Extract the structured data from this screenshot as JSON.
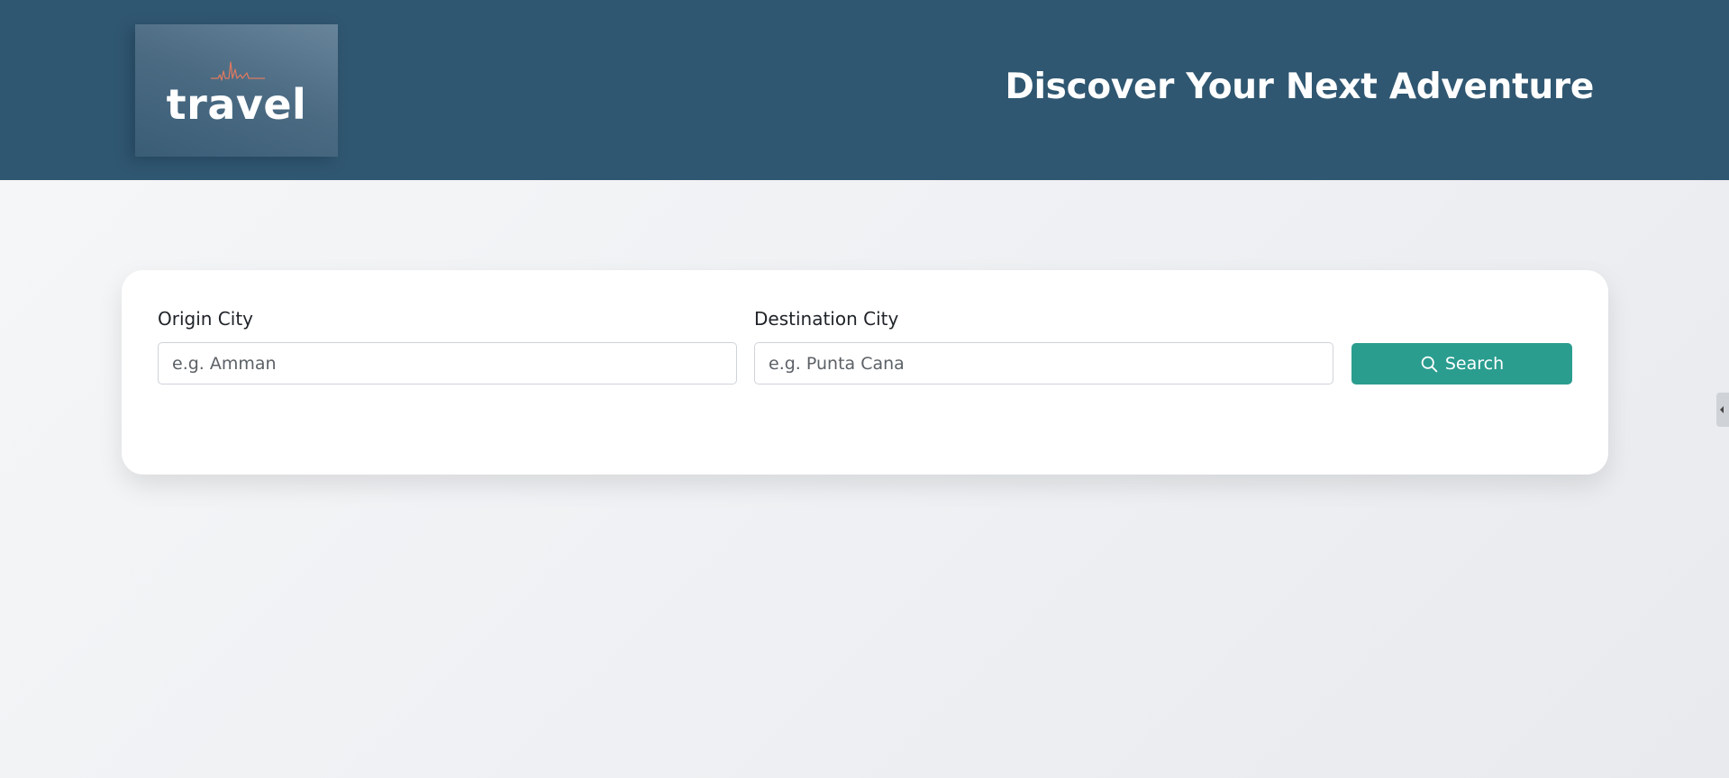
{
  "header": {
    "logo_text": "travel",
    "title": "Discover Your Next Adventure"
  },
  "search": {
    "origin_label": "Origin City",
    "origin_placeholder": "e.g. Amman",
    "origin_value": "",
    "destination_label": "Destination City",
    "destination_placeholder": "e.g. Punta Cana",
    "destination_value": "",
    "button_label": "Search",
    "button_icon": "search-icon"
  },
  "colors": {
    "header_bg": "#305771",
    "accent": "#2a9d8f",
    "logo_wave": "#e07a5f"
  },
  "side_panel": {
    "toggle_icon": "chevron-left-icon"
  }
}
